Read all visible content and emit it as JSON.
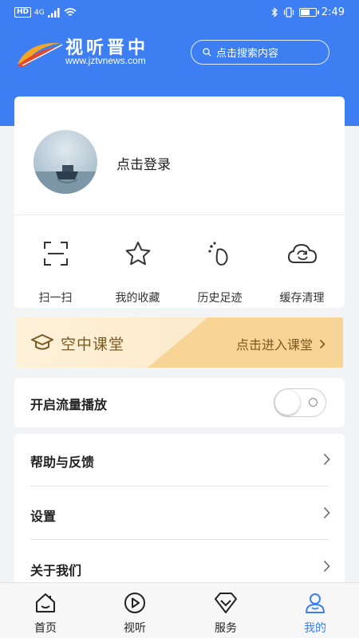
{
  "status_bar": {
    "network_badge": "HD",
    "network_type": "4G",
    "time": "2:49",
    "battery_level": 0.55
  },
  "header": {
    "logo_title": "视听晋中",
    "logo_url": "www.jztvnews.com",
    "search_placeholder": "点击搜索内容"
  },
  "profile": {
    "login_label": "点击登录"
  },
  "quick_actions": [
    {
      "label": "扫一扫",
      "icon": "scan-icon"
    },
    {
      "label": "我的收藏",
      "icon": "star-icon"
    },
    {
      "label": "历史足迹",
      "icon": "footprint-icon"
    },
    {
      "label": "缓存清理",
      "icon": "cloud-refresh-icon"
    }
  ],
  "banner": {
    "title": "空中课堂",
    "link_label": "点击进入课堂"
  },
  "settings": {
    "traffic_play_label": "开启流量播放",
    "traffic_play_enabled": false,
    "help_label": "帮助与反馈",
    "settings_label": "设置",
    "about_label": "关于我们"
  },
  "tabs": [
    {
      "label": "首页",
      "icon": "home-icon",
      "active": false
    },
    {
      "label": "视听",
      "icon": "play-circle-icon",
      "active": false
    },
    {
      "label": "服务",
      "icon": "diamond-icon",
      "active": false
    },
    {
      "label": "我的",
      "icon": "user-icon",
      "active": true
    }
  ],
  "colors": {
    "primary": "#3d7ff2",
    "banner_text": "#7a5a22",
    "banner_bg": "#fce7c2"
  }
}
